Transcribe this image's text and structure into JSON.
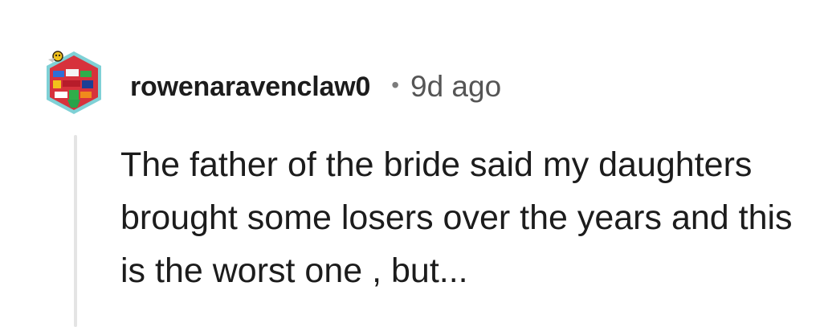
{
  "comment": {
    "author": "rowenaravenclaw0",
    "separator": "•",
    "time_ago": "9d ago",
    "body": "The father of the bride said my daughters brought some losers over the years and this is the worst one , but...",
    "avatar_icon": "user-avatar-icon"
  },
  "colors": {
    "text": "#1c1c1c",
    "meta": "#555555",
    "thread_line": "#e4e4e4",
    "avatar_border": "#7fd1d6",
    "avatar_main": "#d7323c"
  }
}
